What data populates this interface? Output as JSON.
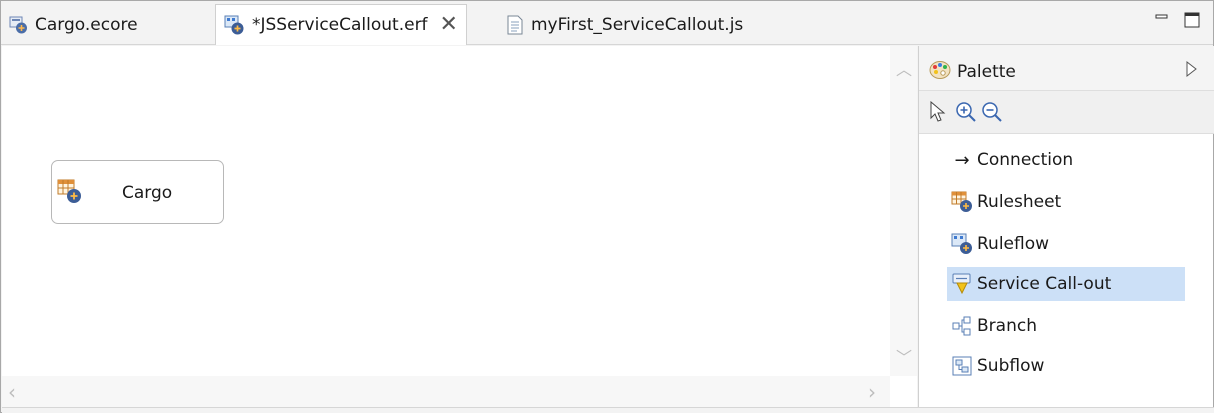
{
  "tabs": [
    {
      "label": "Cargo.ecore",
      "icon": "ecore-model-icon",
      "active": false
    },
    {
      "label": "*JSServiceCallout.erf",
      "icon": "ruleflow-icon",
      "active": true
    },
    {
      "label": "myFirst_ServiceCallout.js",
      "icon": "text-file-icon",
      "active": false
    }
  ],
  "canvas": {
    "nodes": [
      {
        "label": "Cargo",
        "icon": "rulesheet-icon"
      }
    ]
  },
  "palette": {
    "title": "Palette",
    "items": [
      {
        "label": "Connection",
        "icon": "arrow-right-icon",
        "glyph": "→"
      },
      {
        "label": "Rulesheet",
        "icon": "rulesheet-icon"
      },
      {
        "label": "Ruleflow",
        "icon": "ruleflow-icon"
      },
      {
        "label": "Service Call-out",
        "icon": "service-callout-icon",
        "selected": true
      },
      {
        "label": "Branch",
        "icon": "branch-icon"
      },
      {
        "label": "Subflow",
        "icon": "subflow-icon"
      }
    ]
  },
  "colors": {
    "selection": "#cce0f7",
    "chrome": "#f3f3f3"
  }
}
